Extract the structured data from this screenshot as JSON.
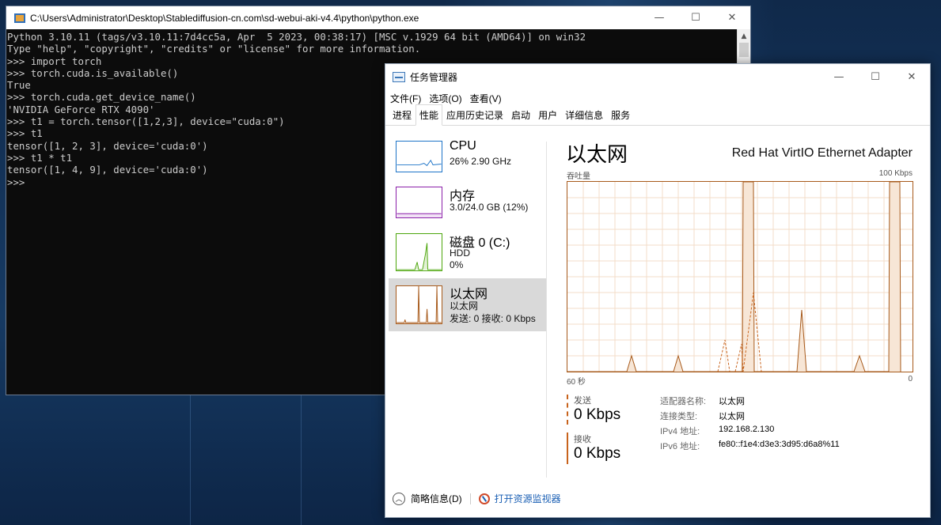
{
  "console": {
    "title": "C:\\Users\\Administrator\\Desktop\\Stablediffusion-cn.com\\sd-webui-aki-v4.4\\python\\python.exe",
    "text": "Python 3.10.11 (tags/v3.10.11:7d4cc5a, Apr  5 2023, 00:38:17) [MSC v.1929 64 bit (AMD64)] on win32\nType \"help\", \"copyright\", \"credits\" or \"license\" for more information.\n>>> import torch\n>>> torch.cuda.is_available()\nTrue\n>>> torch.cuda.get_device_name()\n'NVIDIA GeForce RTX 4090'\n>>> t1 = torch.tensor([1,2,3], device=\"cuda:0\")\n>>> t1\ntensor([1, 2, 3], device='cuda:0')\n>>> t1 * t1\ntensor([1, 4, 9], device='cuda:0')\n>>>"
  },
  "window_buttons": {
    "minimize": "—",
    "maximize": "☐",
    "close": "✕"
  },
  "taskmgr": {
    "title": "任务管理器",
    "menu": [
      "文件(F)",
      "选项(O)",
      "查看(V)"
    ],
    "tabs": [
      "进程",
      "性能",
      "应用历史记录",
      "启动",
      "用户",
      "详细信息",
      "服务"
    ],
    "active_tab": "性能",
    "sidebar": [
      {
        "name": "CPU",
        "line1": "26%  2.90 GHz",
        "line2": "",
        "color": "#1d74c8"
      },
      {
        "name": "内存",
        "line1": "3.0/24.0 GB (12%)",
        "line2": "",
        "color": "#8b1fa9"
      },
      {
        "name": "磁盘 0 (C:)",
        "line1": "HDD",
        "line2": "0%",
        "color": "#4da60c"
      },
      {
        "name": "以太网",
        "line1": "以太网",
        "line2": "发送: 0  接收: 0 Kbps",
        "color": "#a75a1b"
      }
    ],
    "detail": {
      "title": "以太网",
      "adapter": "Red Hat VirtIO Ethernet Adapter",
      "graph_label": "吞吐量",
      "graph_max": "100 Kbps",
      "time_left": "60 秒",
      "time_right": "0",
      "send_label": "发送",
      "send_value": "0 Kbps",
      "recv_label": "接收",
      "recv_value": "0 Kbps",
      "props": [
        {
          "key": "适配器名称:",
          "value": "以太网"
        },
        {
          "key": "连接类型:",
          "value": "以太网"
        },
        {
          "key": "IPv4 地址:",
          "value": "192.168.2.130"
        },
        {
          "key": "IPv6 地址:",
          "value": "fe80::f1e4:d3e3:3d95:d6a8%11"
        }
      ]
    },
    "footer": {
      "less_details": "简略信息(D)",
      "open_monitor": "打开资源监视器"
    }
  }
}
